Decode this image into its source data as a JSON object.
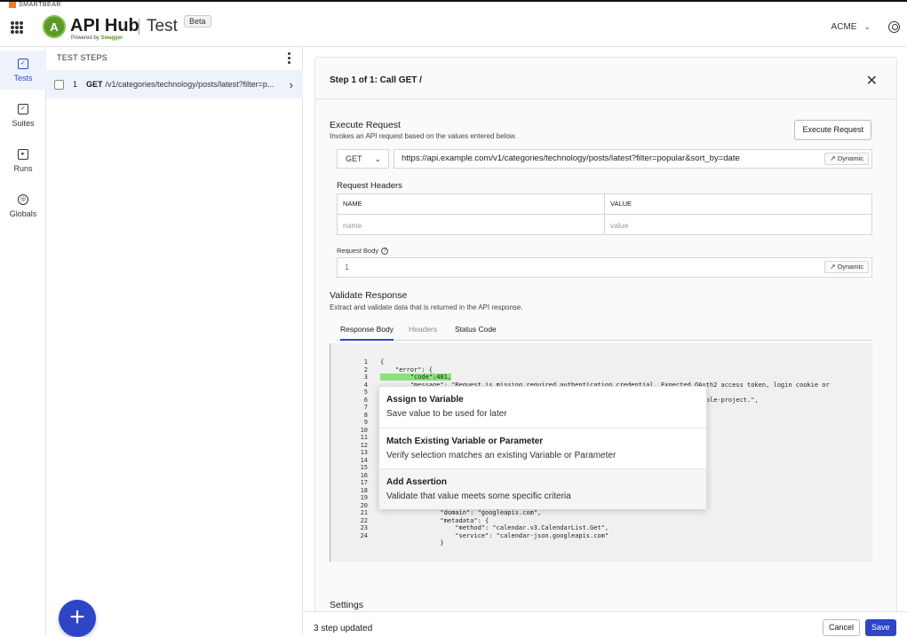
{
  "brand": {
    "company": "SMARTBEAR",
    "app_name": "API Hub",
    "powered_prefix": "Powered by",
    "powered_brand": "Swagger",
    "logo_letter": "A",
    "product": "Test",
    "badge": "Beta"
  },
  "header": {
    "org": "ACME"
  },
  "rail": {
    "items": [
      {
        "label": "Tests",
        "icon": "chart-icon",
        "active": true
      },
      {
        "label": "Suites",
        "icon": "suites-icon"
      },
      {
        "label": "Runs",
        "icon": "runs-icon"
      },
      {
        "label": "Globals",
        "icon": "globe-icon"
      }
    ]
  },
  "steps": {
    "heading": "TEST STEPS",
    "items": [
      {
        "num": "1",
        "method": "GET",
        "path": "/v1/categories/technology/posts/latest?filter=p..."
      }
    ]
  },
  "step": {
    "title": "Step 1 of 1: Call GET /"
  },
  "execute": {
    "title": "Execute Request",
    "subtitle": "Invokes an API request based on the values entered below.",
    "button": "Execute Request",
    "method": "GET",
    "url": "https://api.example.com/v1/categories/technology/posts/latest?filter=popular&sort_by=date",
    "dynamic_label": "Dynamic"
  },
  "headers": {
    "title": "Request Headers",
    "col_name": "NAME",
    "col_value": "VALUE",
    "placeholder_name": "name",
    "placeholder_value": "value"
  },
  "body": {
    "title": "Request Body",
    "value": "1",
    "dynamic_label": "Dynamic"
  },
  "validate": {
    "title": "Validate Response",
    "subtitle": "Extract and validate data that is returned in the API response.",
    "tabs": [
      "Response Body",
      "Headers",
      "Status Code"
    ]
  },
  "code": {
    "lines": [
      {
        "n": "1",
        "t": "{"
      },
      {
        "n": "2",
        "t": "    \"error\": {"
      },
      {
        "n": "3",
        "t": "        \"code\":401,",
        "hl": true
      },
      {
        "n": "4",
        "t": "        \"message\": \"Request is missing required authentication credential. Expected OAuth2 access token, login cookie or"
      },
      {
        "n": "5",
        "t": ""
      },
      {
        "n": "6",
        "t": "                                                                                     nsole-project.\","
      },
      {
        "n": "7",
        "t": ""
      },
      {
        "n": "8",
        "t": ""
      },
      {
        "n": "9",
        "t": ""
      },
      {
        "n": "10",
        "t": ""
      },
      {
        "n": "11",
        "t": ""
      },
      {
        "n": "12",
        "t": ""
      },
      {
        "n": "13",
        "t": ""
      },
      {
        "n": "14",
        "t": ""
      },
      {
        "n": "15",
        "t": ""
      },
      {
        "n": "16",
        "t": ""
      },
      {
        "n": "17",
        "t": ""
      },
      {
        "n": "18",
        "t": ""
      },
      {
        "n": "19",
        "t": ""
      },
      {
        "n": "20",
        "t": ""
      },
      {
        "n": "21",
        "t": "                \"domain\": \"googleapis.com\","
      },
      {
        "n": "22",
        "t": "                \"metadata\": {"
      },
      {
        "n": "23",
        "t": "                    \"method\": \"calendar.v3.CalendarList.Get\","
      },
      {
        "n": "24",
        "t": "                    \"service\": \"calendar-json.googleapis.com\""
      },
      {
        "n": "",
        "t": "                }"
      }
    ]
  },
  "popup": {
    "options": [
      {
        "title": "Assign to Variable",
        "desc": "Save value to be used for later"
      },
      {
        "title": "Match Existing Variable or Parameter",
        "desc": "Verify selection matches an existing Variable or Parameter"
      },
      {
        "title": "Add Assertion",
        "desc": "Validate that value meets some specific criteria"
      }
    ]
  },
  "settings": {
    "title": "Settings"
  },
  "footer": {
    "status": "3 step updated",
    "cancel": "Cancel",
    "save": "Save"
  },
  "colors": {
    "accent": "#2e45c6",
    "highlight": "#8de07e",
    "brand_green": "#5a9a2a"
  }
}
